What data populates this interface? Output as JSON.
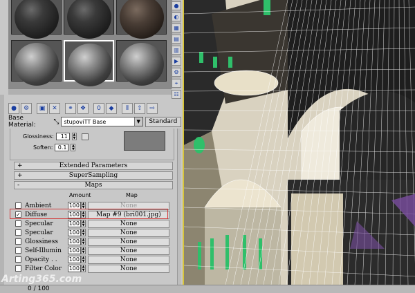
{
  "material_editor": {
    "base_material_label": "Base Material:",
    "material_name": "stupoviTT Base",
    "type_button": "Standard",
    "glossiness_label": "Glossiness:",
    "glossiness_value": "11",
    "soften_label": "Soften:",
    "soften_value": "0.1",
    "rollouts": {
      "extended": "Extended Parameters",
      "supersampling": "SuperSampling",
      "maps": "Maps",
      "plus": "+",
      "minus": "-"
    },
    "maps_headers": {
      "amount": "Amount",
      "map": "Map"
    },
    "maps": [
      {
        "name": "Ambient",
        "checked": false,
        "amount": "100",
        "map": "None",
        "dim": true
      },
      {
        "name": "Diffuse",
        "checked": true,
        "amount": "100",
        "map": "Map #9 (bri001.jpg)",
        "dim": false
      },
      {
        "name": "Specular",
        "checked": false,
        "amount": "100",
        "map": "None",
        "dim": false
      },
      {
        "name": "Specular",
        "checked": false,
        "amount": "100",
        "map": "None",
        "dim": false
      },
      {
        "name": "Glossiness",
        "checked": false,
        "amount": "100",
        "map": "None",
        "dim": false
      },
      {
        "name": "Self-Illumin",
        "checked": false,
        "amount": "100",
        "map": "None",
        "dim": false
      },
      {
        "name": "Opacity . .",
        "checked": false,
        "amount": "100",
        "map": "None",
        "dim": false
      },
      {
        "name": "Filter Color",
        "checked": false,
        "amount": "100",
        "map": "None",
        "dim": false
      }
    ],
    "check_mark": "✓"
  },
  "status": {
    "frame_counter": "0 / 100"
  },
  "watermark": "Arting365.com",
  "colors": {
    "highlight_box": "#d23a3a",
    "viewport_border": "#d8c63a",
    "wire": "#ffffff",
    "green_window": "#2fbf6a"
  }
}
